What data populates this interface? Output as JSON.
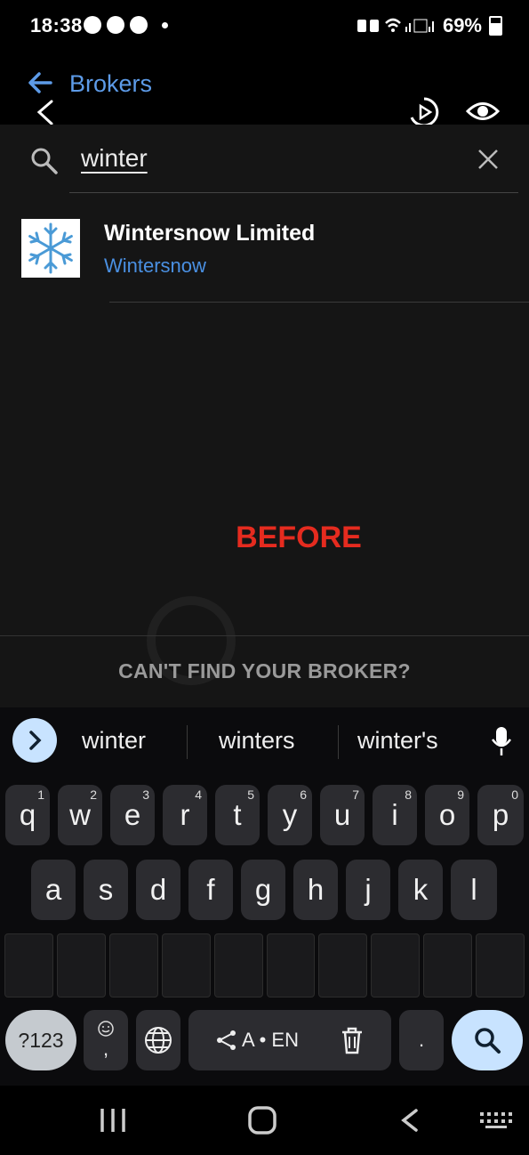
{
  "status_bar": {
    "time": "18:38",
    "battery": "69%"
  },
  "header": {
    "title": "Brokers"
  },
  "search": {
    "value": "winter"
  },
  "results": [
    {
      "name": "Wintersnow Limited",
      "subtitle": "Wintersnow"
    }
  ],
  "overlay_label": "BEFORE",
  "footer": {
    "cant_find": "CAN'T FIND YOUR BROKER?"
  },
  "keyboard": {
    "suggestions": [
      "winter",
      "winters",
      "winter's"
    ],
    "row1": [
      {
        "k": "q",
        "h": "1"
      },
      {
        "k": "w",
        "h": "2"
      },
      {
        "k": "e",
        "h": "3"
      },
      {
        "k": "r",
        "h": "4"
      },
      {
        "k": "t",
        "h": "5"
      },
      {
        "k": "y",
        "h": "6"
      },
      {
        "k": "u",
        "h": "7"
      },
      {
        "k": "i",
        "h": "8"
      },
      {
        "k": "o",
        "h": "9"
      },
      {
        "k": "p",
        "h": "0"
      }
    ],
    "row2": [
      "a",
      "s",
      "d",
      "f",
      "g",
      "h",
      "j",
      "k",
      "l"
    ],
    "num_key": "?123",
    "emoji_comma": ",",
    "lang": "A • EN",
    "period": "."
  },
  "colors": {
    "accent_blue": "#4a90e2",
    "before_red": "#e52b1f",
    "key_bg": "#2c2c30"
  }
}
